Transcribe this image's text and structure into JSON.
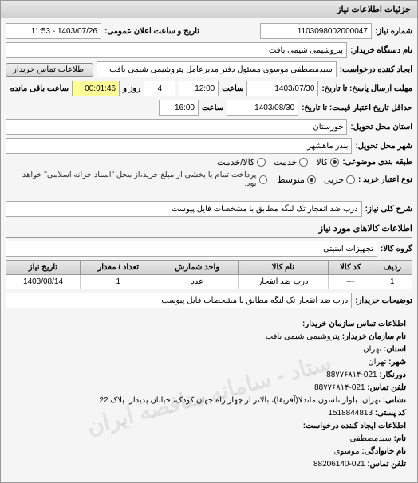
{
  "panel_title": "جزئیات اطلاعات نیاز",
  "header": {
    "need_number_label": "شماره نیاز:",
    "need_number": "1103098002000047",
    "announce_datetime_label": "تاریخ و ساعت اعلان عمومی:",
    "announce_datetime": "1403/07/26 - 11:53"
  },
  "buyer": {
    "buyer_device_label": "نام دستگاه خریدار:",
    "buyer_device": "پتروشیمی شیمی بافت",
    "creator_label": "ایجاد کننده درخواست:",
    "creator": "سیدمصطفی موسوی مسئول دفتر مدیرعامل پتروشیمی شیمی بافت",
    "contact_button": "اطلاعات تماس خریدار"
  },
  "deadlines": {
    "response_deadline_label": "مهلت ارسال پاسخ: تا تاریخ:",
    "response_date": "1403/07/30",
    "time_label": "ساعت",
    "response_time": "12:00",
    "days_remaining": "4",
    "days_label": "روز و",
    "time_remaining": "00:01:46",
    "remaining_label": "ساعت باقی مانده",
    "validity_deadline_label": "حداقل تاریخ اعتبار قیمت: تا تاریخ:",
    "validity_date": "1403/08/30",
    "validity_time": "16:00"
  },
  "location": {
    "province_label": "استان محل تحویل:",
    "province": "خوزستان",
    "city_label": "شهر محل تحویل:",
    "city": "بندر ماهشهر"
  },
  "classification": {
    "subject_class_label": "طبقه بندی موضوعی:",
    "option_goods": "کالا",
    "option_service": "خدمت",
    "option_goods_service": "کالا/خدمت",
    "purchase_type_label": "نوع اعتبار خرید :",
    "option_partial": "جزیی",
    "option_medium": "متوسط",
    "payment_note": "پرداخت تمام یا بخشی از مبلغ خرید،از محل \"اسناد خزانه اسلامی\" خواهد بود."
  },
  "description": {
    "need_desc_label": "شرح کلی نیاز:",
    "need_desc": "درب ضد انفجار تک لنگه مطابق با مشخصات فایل پیوست"
  },
  "goods_section_title": "اطلاعات کالاهای مورد نیاز",
  "goods_group": {
    "label": "گروه کالا:",
    "value": "تجهیزات امنیتی"
  },
  "table": {
    "headers": [
      "ردیف",
      "کد کالا",
      "نام کالا",
      "واحد شمارش",
      "تعداد / مقدار",
      "تاریخ نیاز"
    ],
    "rows": [
      {
        "index": "1",
        "code": "---",
        "name": "درب ضد انفجار",
        "unit": "عدد",
        "qty": "1",
        "date": "1403/08/14"
      }
    ]
  },
  "buyer_notes": {
    "label": "توضیحات خریدار:",
    "value": "درب ضد انفجار تک لنگه مطابق با مشخصات فایل پیوست"
  },
  "watermark_text": "ستاد - سامانه مناقصه ایران",
  "contact": {
    "title": "اطلاعات تماس سازمان خریدار:",
    "org_name_label": "نام سازمان خریدار:",
    "org_name": "پتروشیمی شیمی بافت",
    "province_label": "استان:",
    "province": "تهران",
    "city_label": "شهر:",
    "city": "تهران",
    "distributor_label": "دورنگار:",
    "distributor": "021-88۷۷۶۸۱۴",
    "phone_label": "تلفن تماس:",
    "phone": "021-88۷۷۶۸۱۴",
    "address_label": "نشانی:",
    "address": "تهران، بلوار نلسون ماندلا(آفریقا)، بالاتر از چهار راه جهان کودک، خیابان پدیدار، پلاک 22",
    "postal_label": "کد پستی:",
    "postal": "1518844813",
    "creator_section_label": "اطلاعات ایجاد کننده درخواست:",
    "name_label": "نام:",
    "name": "سیدمصطفی",
    "family_label": "نام خانوادگی:",
    "family": "موسوی",
    "creator_phone_label": "تلفن تماس:",
    "creator_phone": "021-88206140"
  }
}
